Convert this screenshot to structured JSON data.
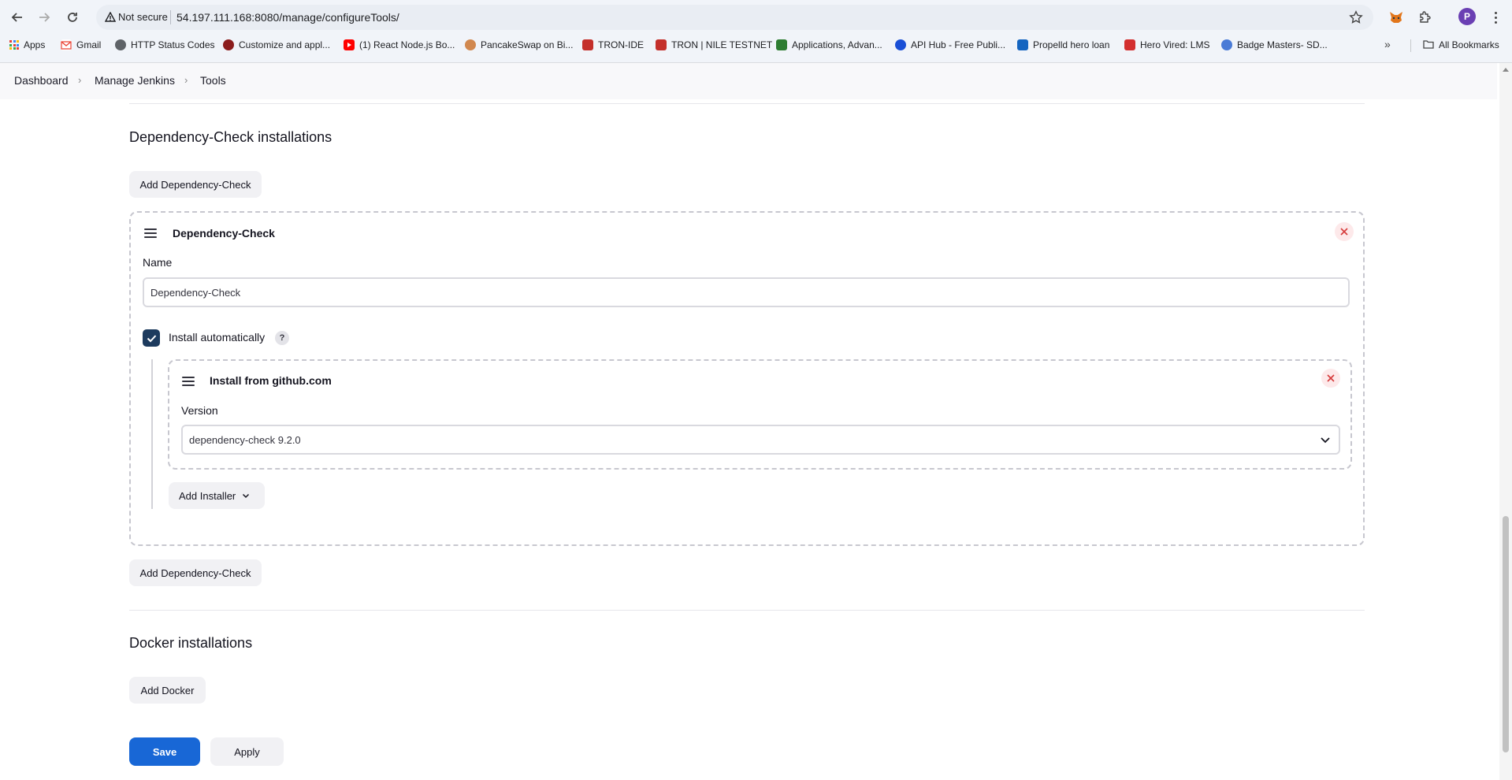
{
  "browser": {
    "security_label": "Not secure",
    "url": "54.197.111.168:8080/manage/configureTools/",
    "profile_initial": "P",
    "bookmarks": [
      {
        "label": "Apps",
        "color": "#4285f4"
      },
      {
        "label": "Gmail",
        "color": "#ea4335"
      },
      {
        "label": "HTTP Status Codes",
        "color": "#5f6368"
      },
      {
        "label": "Customize and appl...",
        "color": "#8b1c1c"
      },
      {
        "label": "(1) React Node.js Bo...",
        "color": "#ff0000"
      },
      {
        "label": "PancakeSwap on Bi...",
        "color": "#d1884f"
      },
      {
        "label": "TRON-IDE",
        "color": "#c4302b"
      },
      {
        "label": "TRON | NILE TESTNET",
        "color": "#c4302b"
      },
      {
        "label": "Applications, Advan...",
        "color": "#2e7d32"
      },
      {
        "label": "API Hub - Free Publi...",
        "color": "#1a4fd6"
      },
      {
        "label": "Propelld hero loan",
        "color": "#1565c0"
      },
      {
        "label": "Hero Vired: LMS",
        "color": "#d32f2f"
      },
      {
        "label": "Badge Masters- SD...",
        "color": "#4a7bd6"
      }
    ],
    "all_bookmarks_label": "All Bookmarks"
  },
  "breadcrumb": {
    "items": [
      "Dashboard",
      "Manage Jenkins",
      "Tools"
    ]
  },
  "dependency_check": {
    "section_title": "Dependency-Check installations",
    "add_button_label": "Add Dependency-Check",
    "card": {
      "title": "Dependency-Check",
      "name_label": "Name",
      "name_value": "Dependency-Check",
      "install_auto_label": "Install automatically",
      "install_auto_checked": true,
      "help_label": "?",
      "installer": {
        "title": "Install from github.com",
        "version_label": "Version",
        "version_value": "dependency-check 9.2.0"
      },
      "add_installer_label": "Add Installer"
    },
    "add_button_bottom_label": "Add Dependency-Check"
  },
  "docker": {
    "section_title": "Docker installations",
    "add_button_label": "Add Docker"
  },
  "actions": {
    "save_label": "Save",
    "apply_label": "Apply"
  },
  "colors": {
    "primary": "#1867d6",
    "checkbox": "#1d3b5e",
    "close_bg": "#fde9ea",
    "close_x": "#d63a3a"
  }
}
